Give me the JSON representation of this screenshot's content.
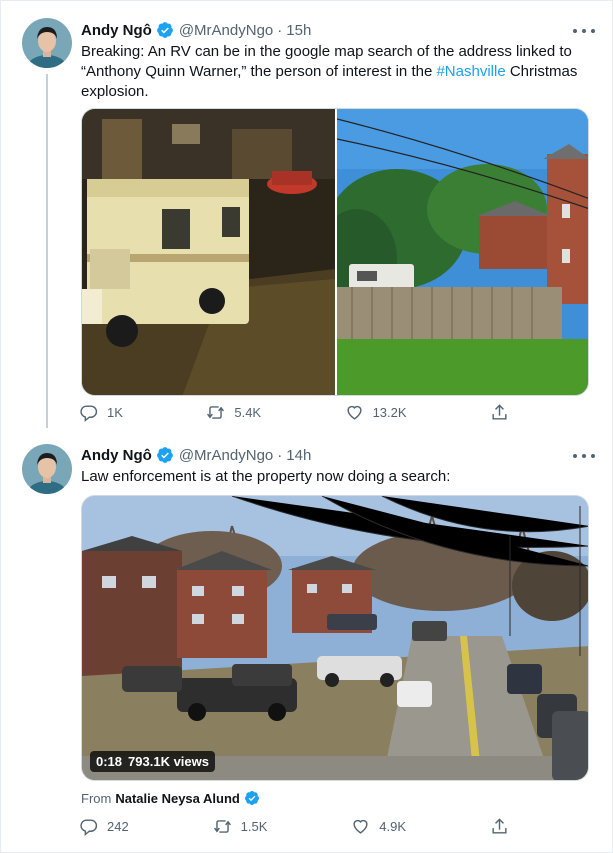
{
  "tweets": [
    {
      "name": "Andy Ngô",
      "handle": "@MrAndyNgo",
      "separator": "·",
      "time": "15h",
      "text_before": "Breaking: An RV can be in the google map search of the address linked to “Anthony Quinn Warner,” the person of interest in the ",
      "hashtag": "#Nashville",
      "text_after": " Christmas explosion.",
      "reply_count": "1K",
      "retweet_count": "5.4K",
      "like_count": "13.2K"
    },
    {
      "name": "Andy Ngô",
      "handle": "@MrAndyNgo",
      "separator": "·",
      "time": "14h",
      "text": "Law enforcement is at the property now doing a search:",
      "video_duration": "0:18",
      "video_views": "793.1K views",
      "from_prefix": "From",
      "from_name": "Natalie Neysa Alund",
      "reply_count": "242",
      "retweet_count": "1.5K",
      "like_count": "4.9K"
    }
  ],
  "icons": {
    "verified": "verified-badge-icon",
    "reply": "reply-icon",
    "retweet": "retweet-icon",
    "like": "heart-icon",
    "share": "share-icon",
    "more": "more-dots-icon"
  },
  "colors": {
    "accent": "#1da1f2",
    "secondary_text": "#536471",
    "thread_line": "#c4cfd6"
  }
}
